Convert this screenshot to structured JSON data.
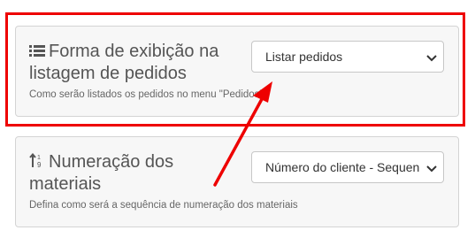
{
  "settings": [
    {
      "icon": "list-icon",
      "title": "Forma de exibição na listagem de pedidos",
      "hint": "Como serão listados os pedidos no menu \"Pedidos\"?",
      "select_value": "Listar pedidos"
    },
    {
      "icon": "numeric-sort-icon",
      "title": "Numeração dos materiais",
      "hint": "Defina como será a sequência de numeração dos materiais",
      "select_value": "Número do cliente - Sequencial"
    }
  ],
  "annotation": {
    "color": "#ee0000"
  }
}
